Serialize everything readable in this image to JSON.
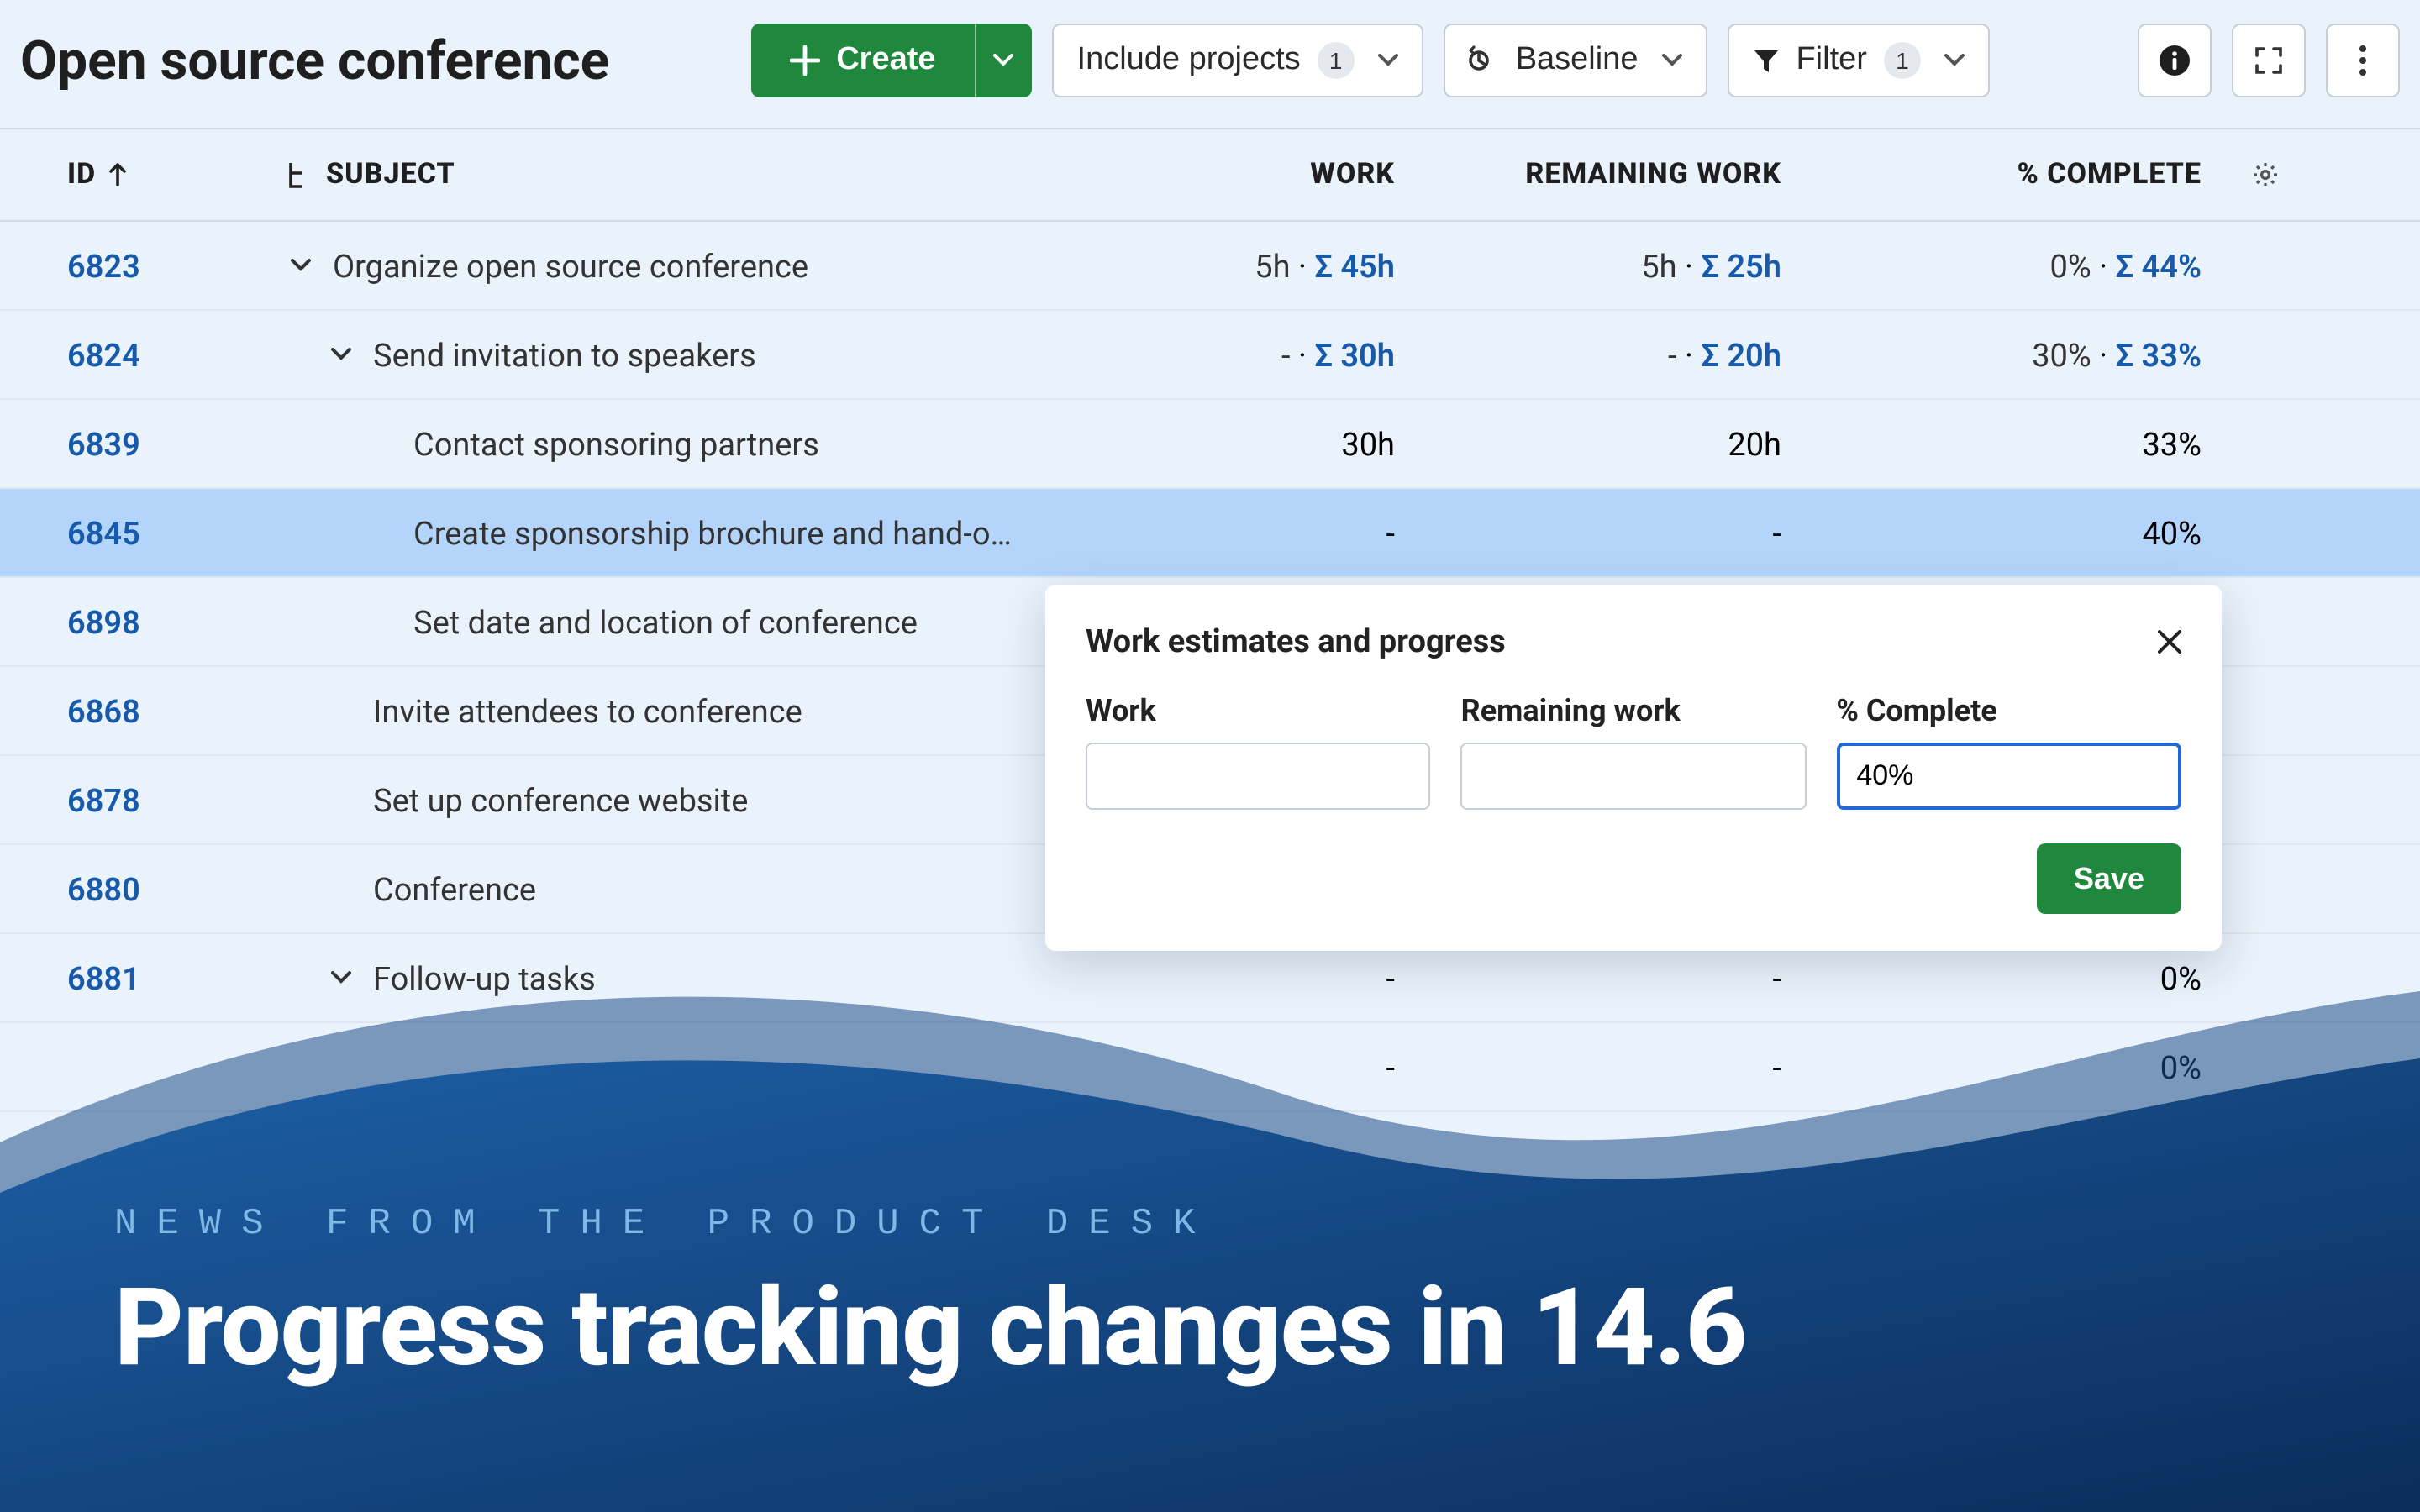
{
  "page": {
    "title": "Open source conference"
  },
  "toolbar": {
    "create_label": "Create",
    "include_projects_label": "Include projects",
    "include_projects_count": "1",
    "baseline_label": "Baseline",
    "filter_label": "Filter",
    "filter_count": "1"
  },
  "columns": {
    "id": "ID",
    "subject": "SUBJECT",
    "work": "WORK",
    "remaining": "REMAINING WORK",
    "complete": "% COMPLETE"
  },
  "rows": [
    {
      "id": "6823",
      "subject": "Organize open source conference",
      "indent": 1,
      "expandable": true,
      "work_val": "5h",
      "work_sigma": "Σ 45h",
      "remaining_val": "5h",
      "remaining_sigma": "Σ 25h",
      "complete_val": "0%",
      "complete_sigma": "Σ 44%",
      "selected": false
    },
    {
      "id": "6824",
      "subject": "Send invitation to speakers",
      "indent": 2,
      "expandable": true,
      "work_val": "-",
      "work_sigma": "Σ 30h",
      "remaining_val": "-",
      "remaining_sigma": "Σ 20h",
      "complete_val": "30%",
      "complete_sigma": "Σ 33%",
      "selected": false
    },
    {
      "id": "6839",
      "subject": "Contact sponsoring partners",
      "indent": 3,
      "expandable": false,
      "work_val": "30h",
      "work_sigma": "",
      "remaining_val": "20h",
      "remaining_sigma": "",
      "complete_val": "33%",
      "complete_sigma": "",
      "selected": false
    },
    {
      "id": "6845",
      "subject": "Create sponsorship brochure and hand-o…",
      "indent": 3,
      "expandable": false,
      "work_val": "-",
      "work_sigma": "",
      "remaining_val": "-",
      "remaining_sigma": "",
      "complete_val": "40%",
      "complete_sigma": "",
      "selected": true
    },
    {
      "id": "6898",
      "subject": "Set date and location of conference",
      "indent": 3,
      "expandable": false,
      "work_val": "",
      "work_sigma": "",
      "remaining_val": "",
      "remaining_sigma": "",
      "complete_val": "",
      "complete_sigma": "",
      "selected": false
    },
    {
      "id": "6868",
      "subject": "Invite attendees to conference",
      "indent": 2,
      "expandable": false,
      "work_val": "",
      "work_sigma": "",
      "remaining_val": "",
      "remaining_sigma": "",
      "complete_val": "",
      "complete_sigma": "",
      "selected": false
    },
    {
      "id": "6878",
      "subject": "Set up conference website",
      "indent": 2,
      "expandable": false,
      "work_val": "",
      "work_sigma": "",
      "remaining_val": "",
      "remaining_sigma": "",
      "complete_val": "",
      "complete_sigma": "",
      "selected": false
    },
    {
      "id": "6880",
      "subject": "Conference",
      "indent": 2,
      "expandable": false,
      "work_val": "",
      "work_sigma": "",
      "remaining_val": "",
      "remaining_sigma": "",
      "complete_val": "",
      "complete_sigma": "",
      "selected": false
    },
    {
      "id": "6881",
      "subject": "Follow-up tasks",
      "indent": 2,
      "expandable": true,
      "work_val": "-",
      "work_sigma": "",
      "remaining_val": "-",
      "remaining_sigma": "",
      "complete_val": "0%",
      "complete_sigma": "",
      "selected": false
    },
    {
      "id": "",
      "subject": "",
      "indent": 2,
      "expandable": false,
      "work_val": "-",
      "work_sigma": "",
      "remaining_val": "-",
      "remaining_sigma": "",
      "complete_val": "0%",
      "complete_sigma": "",
      "selected": false
    }
  ],
  "popover": {
    "title": "Work estimates and progress",
    "work_label": "Work",
    "work_value": "",
    "remaining_label": "Remaining work",
    "remaining_value": "",
    "complete_label": "% Complete",
    "complete_value": "40%",
    "save_label": "Save"
  },
  "banner": {
    "kicker": "News from the product desk",
    "headline": "Progress tracking changes in 14.6"
  }
}
